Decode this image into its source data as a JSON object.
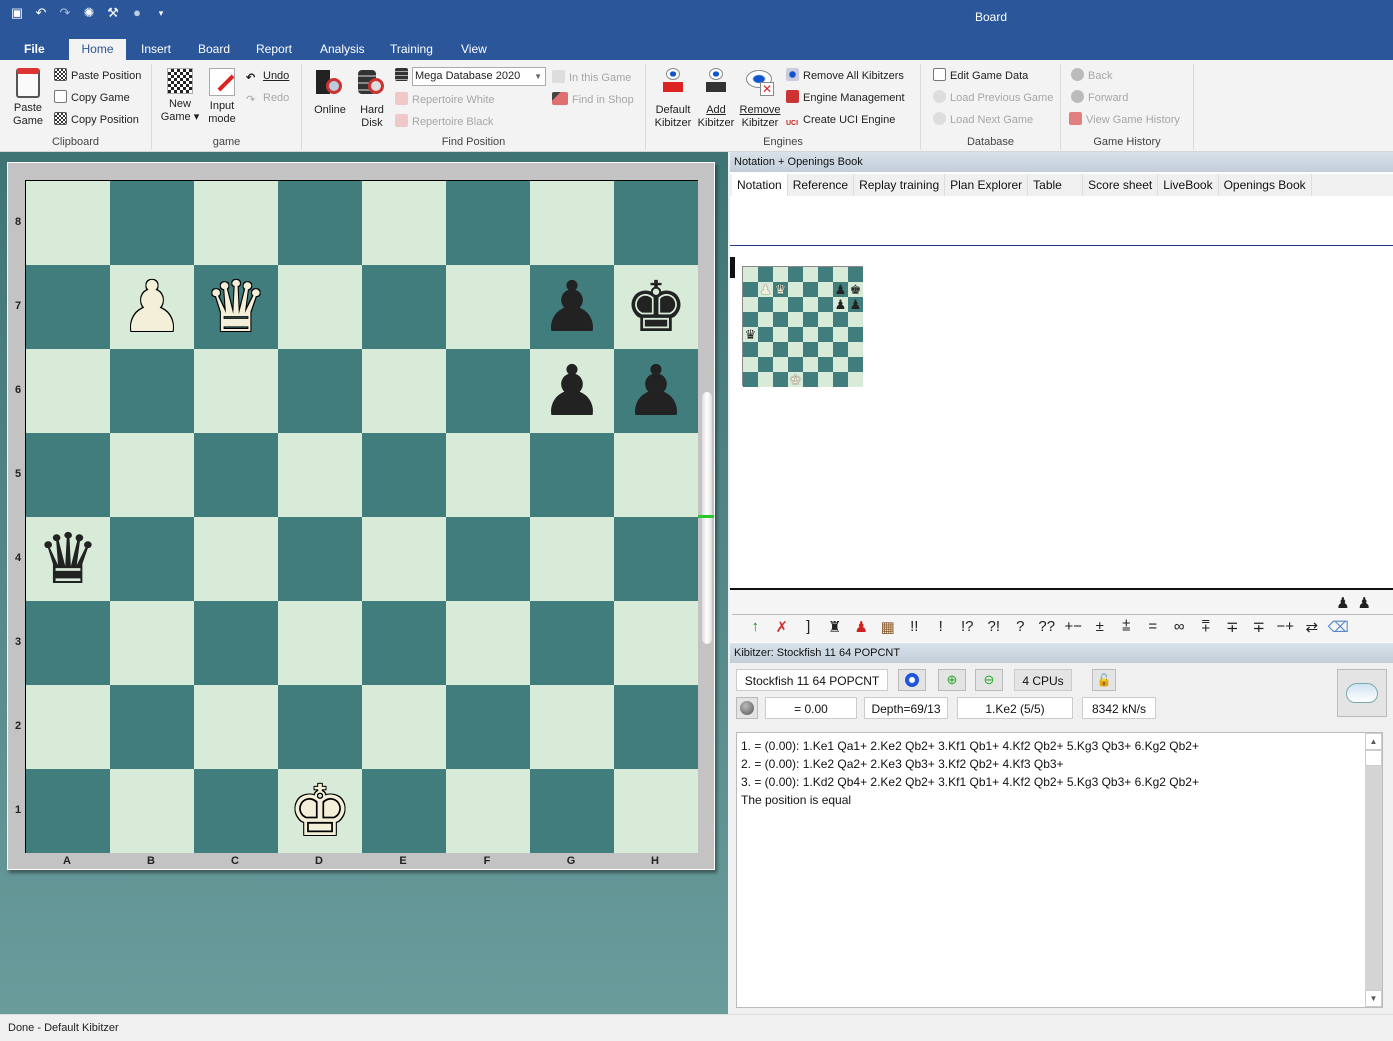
{
  "window": {
    "title": "Board"
  },
  "quick_access": [
    {
      "name": "save-icon",
      "glyph": "▣"
    },
    {
      "name": "undo-icon",
      "glyph": "↶"
    },
    {
      "name": "redo-icon",
      "glyph": "↷"
    },
    {
      "name": "engine-icon",
      "glyph": "✺"
    },
    {
      "name": "wrench-icon",
      "glyph": "✎"
    },
    {
      "name": "lightbulb-icon",
      "glyph": "💡"
    },
    {
      "name": "customize-icon",
      "glyph": "▾"
    }
  ],
  "ribbon_tabs": [
    "File",
    "Home",
    "Insert",
    "Board",
    "Report",
    "Analysis",
    "Training",
    "View"
  ],
  "active_tab": "Home",
  "ribbon": {
    "clipboard": {
      "label": "Clipboard",
      "paste_game": "Paste\nGame",
      "paste_game_l1": "Paste",
      "paste_game_l2": "Game",
      "paste_position": "Paste Position",
      "copy_game": "Copy Game",
      "copy_position": "Copy Position"
    },
    "game": {
      "label": "game",
      "new_game_l1": "New",
      "new_game_l2": "Game ▾",
      "input_mode_l1": "Input",
      "input_mode_l2": "mode",
      "undo": "Undo",
      "redo": "Redo"
    },
    "find_position": {
      "label": "Find Position",
      "online": "Online",
      "hard_disk_l1": "Hard",
      "hard_disk_l2": "Disk",
      "database_select": "Mega Database 2020",
      "repertoire_white": "Repertoire White",
      "repertoire_black": "Repertoire Black",
      "in_this_game": "In this Game",
      "find_in_shop": "Find in Shop"
    },
    "engines": {
      "label": "Engines",
      "default_kibitzer_l1": "Default",
      "default_kibitzer_l2": "Kibitzer",
      "add_kibitzer_l1": "Add",
      "add_kibitzer_l2": "Kibitzer",
      "remove_kibitzer_l1": "Remove",
      "remove_kibitzer_l2": "Kibitzer",
      "remove_all_kibitzers": "Remove All Kibitzers",
      "engine_management": "Engine Management",
      "create_uci_engine": "Create UCI Engine"
    },
    "database": {
      "label": "Database",
      "edit_game_data": "Edit Game Data",
      "load_previous_game": "Load Previous Game",
      "load_next_game": "Load Next Game"
    },
    "game_history": {
      "label": "Game History",
      "back": "Back",
      "forward": "Forward",
      "view_game_history": "View Game History"
    }
  },
  "board": {
    "ranks": [
      "8",
      "7",
      "6",
      "5",
      "4",
      "3",
      "2",
      "1"
    ],
    "files": [
      "A",
      "B",
      "C",
      "D",
      "E",
      "F",
      "G",
      "H"
    ],
    "position": [
      [
        "",
        "",
        "",
        "",
        "",
        "",
        "",
        ""
      ],
      [
        "",
        "wP",
        "wQ",
        "",
        "",
        "",
        "bP",
        "bK"
      ],
      [
        "",
        "",
        "",
        "",
        "",
        "",
        "bP",
        "bP"
      ],
      [
        "",
        "",
        "",
        "",
        "",
        "",
        "",
        ""
      ],
      [
        "bQ",
        "",
        "",
        "",
        "",
        "",
        "",
        ""
      ],
      [
        "",
        "",
        "",
        "",
        "",
        "",
        "",
        ""
      ],
      [
        "",
        "",
        "",
        "",
        "",
        "",
        "",
        ""
      ],
      [
        "",
        "",
        "",
        "wK",
        "",
        "",
        "",
        ""
      ]
    ],
    "colors": {
      "light": "#d8ead8",
      "dark": "#417d7d"
    }
  },
  "notation_panel": {
    "title": "Notation + Openings Book",
    "tabs": [
      "Notation",
      "Reference",
      "Replay training",
      "Plan Explorer",
      "Table",
      "Score sheet",
      "LiveBook",
      "Openings Book"
    ],
    "active_tab": "Notation"
  },
  "annotation_symbols": [
    "↑",
    "✗",
    "]",
    "♜",
    "♟",
    "▦",
    "!!",
    "!",
    "!?",
    "?!",
    "?",
    "??",
    "+−",
    "±",
    "⩲",
    "=",
    "∞",
    "⩱",
    "∓",
    "∓",
    "−+",
    "⇄",
    "⌫"
  ],
  "kibitzer": {
    "title": "Kibitzer: Stockfish 11 64 POPCNT",
    "engine_name": "Stockfish 11 64 POPCNT",
    "cpus": "4 CPUs",
    "evaluation": "= 0.00",
    "depth": "Depth=69/13",
    "current_move": "1.Ke2 (5/5)",
    "speed": "8342 kN/s",
    "lines": [
      "1. = (0.00): 1.Ke1 Qa1+ 2.Ke2 Qb2+ 3.Kf1 Qb1+ 4.Kf2 Qb2+ 5.Kg3 Qb3+ 6.Kg2 Qb2+",
      "2. = (0.00): 1.Ke2 Qa2+ 2.Ke3 Qb3+ 3.Kf2 Qb2+ 4.Kf3 Qb3+",
      "3. = (0.00): 1.Kd2 Qb4+ 2.Ke2 Qb2+ 3.Kf1 Qb1+ 4.Kf2 Qb2+ 5.Kg3 Qb3+ 6.Kg2 Qb2+",
      "The position is equal"
    ]
  },
  "status": {
    "text": "Done - Default Kibitzer"
  }
}
